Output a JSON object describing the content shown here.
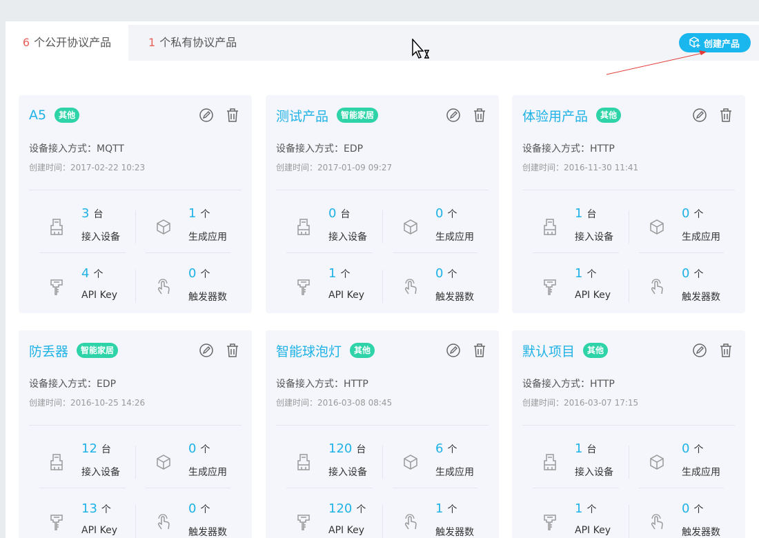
{
  "tabs": {
    "public": {
      "count": "6",
      "label": "个公开协议产品"
    },
    "private": {
      "count": "1",
      "label": "个私有协议产品"
    }
  },
  "create_button": {
    "label": "创建产品"
  },
  "field_labels": {
    "protocol": "设备接入方式：",
    "created": "创建时间："
  },
  "stat_labels": {
    "devices": "接入设备",
    "apps": "生成应用",
    "apikeys": "API Key",
    "triggers": "触发器数"
  },
  "units": {
    "tai": "台",
    "ge": "个"
  },
  "colors": {
    "accent": "#1fb2e6",
    "badge": "#2ed3a8",
    "tab_count": "#e8605c",
    "button": "#1ab6ee"
  },
  "products": [
    {
      "name": "A5",
      "badge": "其他",
      "protocol": "MQTT",
      "created": "2017-02-22 10:23",
      "devices": "3",
      "apps": "1",
      "apikeys": "4",
      "triggers": "0"
    },
    {
      "name": "测试产品",
      "badge": "智能家居",
      "protocol": "EDP",
      "created": "2017-01-09 09:27",
      "devices": "0",
      "apps": "0",
      "apikeys": "1",
      "triggers": "0"
    },
    {
      "name": "体验用产品",
      "badge": "其他",
      "protocol": "HTTP",
      "created": "2016-11-30 11:41",
      "devices": "1",
      "apps": "0",
      "apikeys": "1",
      "triggers": "0"
    },
    {
      "name": "防丢器",
      "badge": "智能家居",
      "protocol": "EDP",
      "created": "2016-10-25 14:26",
      "devices": "12",
      "apps": "0",
      "apikeys": "13",
      "triggers": "0"
    },
    {
      "name": "智能球泡灯",
      "badge": "其他",
      "protocol": "HTTP",
      "created": "2016-03-08 08:45",
      "devices": "120",
      "apps": "6",
      "apikeys": "120",
      "triggers": "1"
    },
    {
      "name": "默认项目",
      "badge": "其他",
      "protocol": "HTTP",
      "created": "2016-03-07 17:15",
      "devices": "1",
      "apps": "0",
      "apikeys": "1",
      "triggers": "0"
    }
  ]
}
